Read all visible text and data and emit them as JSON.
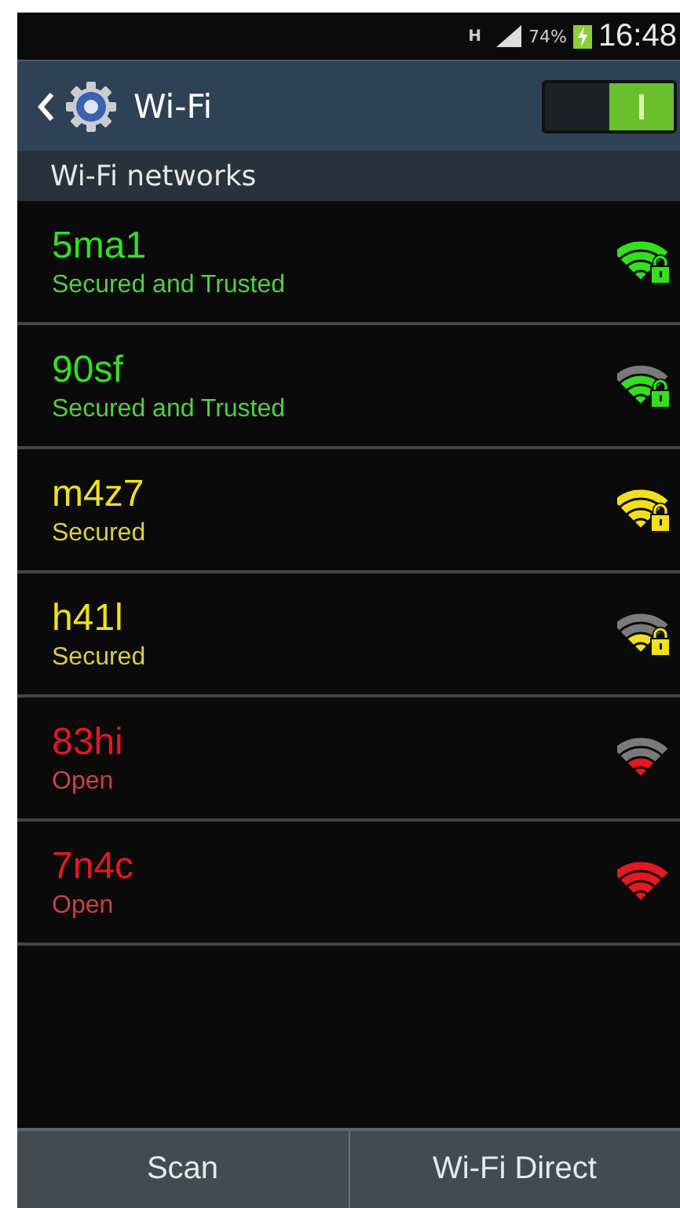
{
  "status_bar": {
    "network_type": "H",
    "battery": "74%",
    "charging": true,
    "time": "16:48"
  },
  "action_bar": {
    "title": "Wi-Fi",
    "wifi_on": true
  },
  "section_header": "Wi-Fi networks",
  "networks": [
    {
      "name": "5ma1",
      "status": "Secured and Trusted",
      "color": "#33e01f",
      "secured": true,
      "kind": "strong"
    },
    {
      "name": "90sf",
      "status": "Secured and Trusted",
      "color": "#33e01f",
      "secured": true,
      "kind": "good"
    },
    {
      "name": "m4z7",
      "status": "Secured",
      "color": "#f2e01a",
      "secured": true,
      "kind": "strong"
    },
    {
      "name": "h41l",
      "status": "Secured",
      "color": "#f2e01a",
      "secured": true,
      "kind": "fair"
    },
    {
      "name": "83hi",
      "status": "Open",
      "color": "#e8161e",
      "secured": false,
      "kind": "fair"
    },
    {
      "name": "7n4c",
      "status": "Open",
      "color": "#e8161e",
      "secured": false,
      "kind": "strong"
    }
  ],
  "bottom_buttons": [
    "Scan",
    "Wi-Fi Direct"
  ]
}
